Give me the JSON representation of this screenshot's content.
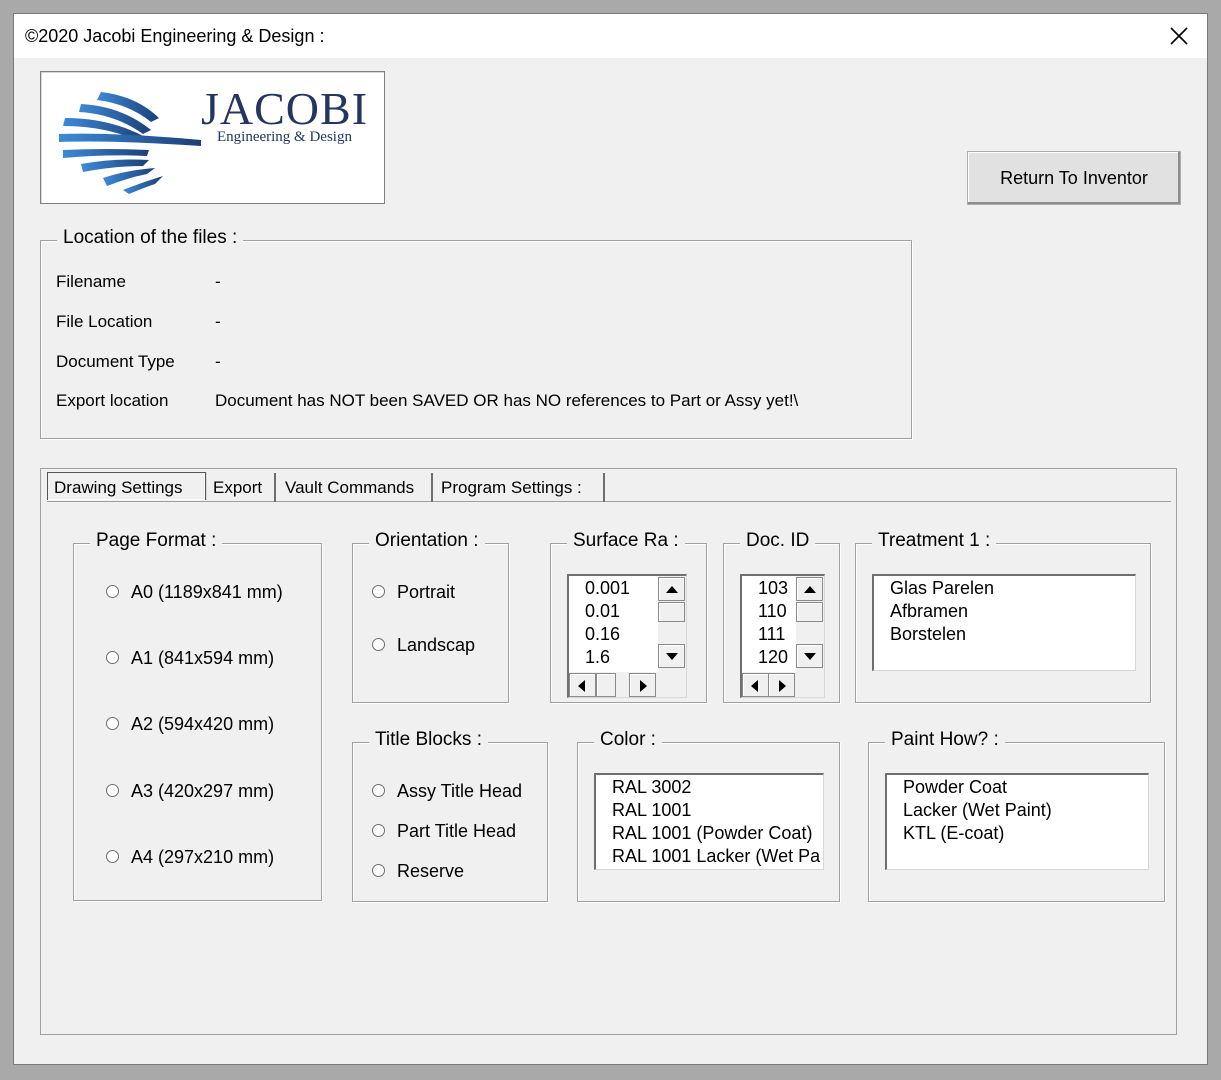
{
  "window": {
    "title": "©2020 Jacobi Engineering & Design :"
  },
  "logo": {
    "name": "JACOBI",
    "subtitle": "Engineering & Design"
  },
  "return_button": "Return To Inventor",
  "files": {
    "caption": "Location of the files :",
    "rows": [
      {
        "label": "Filename",
        "value": "-"
      },
      {
        "label": "File Location",
        "value": "-"
      },
      {
        "label": "Document Type",
        "value": "-"
      },
      {
        "label": "Export location",
        "value": "Document has NOT been SAVED OR has NO references to Part or Assy yet!\\"
      }
    ]
  },
  "tabs": [
    "Drawing Settings",
    "Export",
    "Vault Commands",
    "Program Settings :"
  ],
  "page_format": {
    "caption": "Page Format :",
    "options": [
      "A0 (1189x841 mm)",
      "A1 (841x594 mm)",
      "A2 (594x420 mm)",
      "A3 (420x297 mm)",
      "A4 (297x210 mm)"
    ]
  },
  "orientation": {
    "caption": "Orientation :",
    "options": [
      "Portrait",
      "Landscap"
    ]
  },
  "title_blocks": {
    "caption": "Title Blocks :",
    "options": [
      "Assy Title Head",
      "Part Title Head",
      "Reserve"
    ]
  },
  "surface_ra": {
    "caption": "Surface Ra :",
    "items": [
      "0.001",
      "0.01",
      "0.16",
      "1.6"
    ]
  },
  "doc_id": {
    "caption": "Doc. ID",
    "items": [
      "103",
      "110",
      "111",
      "120"
    ]
  },
  "treatment": {
    "caption": "Treatment 1 :",
    "items": [
      "Glas Parelen",
      "Afbramen",
      "Borstelen"
    ]
  },
  "color": {
    "caption": "Color :",
    "items": [
      "RAL 3002",
      "RAL 1001",
      "RAL 1001 (Powder Coat)",
      "RAL 1001 Lacker (Wet Pa"
    ]
  },
  "paint_how": {
    "caption": "Paint How? :",
    "items": [
      "Powder Coat",
      "Lacker (Wet Paint)",
      "KTL (E-coat)"
    ]
  },
  "colors": {
    "logo_text": "#23365e",
    "logo_blue": "#2f6db0",
    "window_bg": "#f0f0f0"
  }
}
